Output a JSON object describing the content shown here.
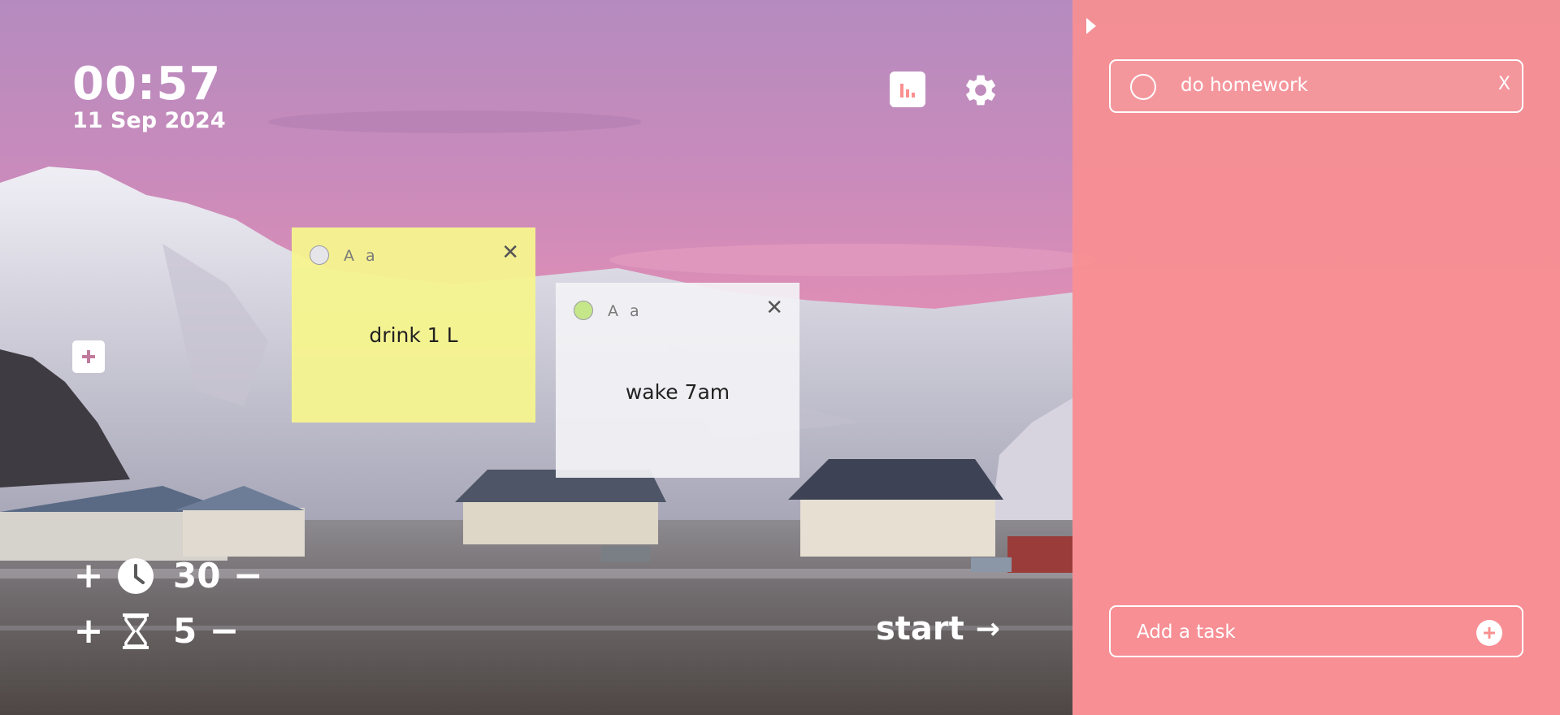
{
  "clock": {
    "time": "00:57",
    "date": "11 Sep 2024"
  },
  "header_icons": [
    "stats-icon",
    "gear-icon"
  ],
  "notes": [
    {
      "color": "#f6f48e",
      "dot_color": "#e6e6ea",
      "format_label": "A a",
      "text": "drink 1 L"
    },
    {
      "color": "#f2f2f5",
      "dot_color": "#c6e68a",
      "format_label": "A a",
      "text": "wake 7am"
    }
  ],
  "timer": {
    "focus": {
      "plus": "+",
      "value": "30",
      "minus": "−",
      "icon": "clock-icon"
    },
    "break": {
      "plus": "+",
      "value": "5",
      "minus": "−",
      "icon": "hourglass-icon"
    }
  },
  "start": {
    "label": "start",
    "arrow": "→"
  },
  "tasks_panel": {
    "accent": "#fa9090",
    "tasks": [
      {
        "text": "do homework",
        "close": "X"
      }
    ],
    "add_placeholder": "Add a task"
  }
}
